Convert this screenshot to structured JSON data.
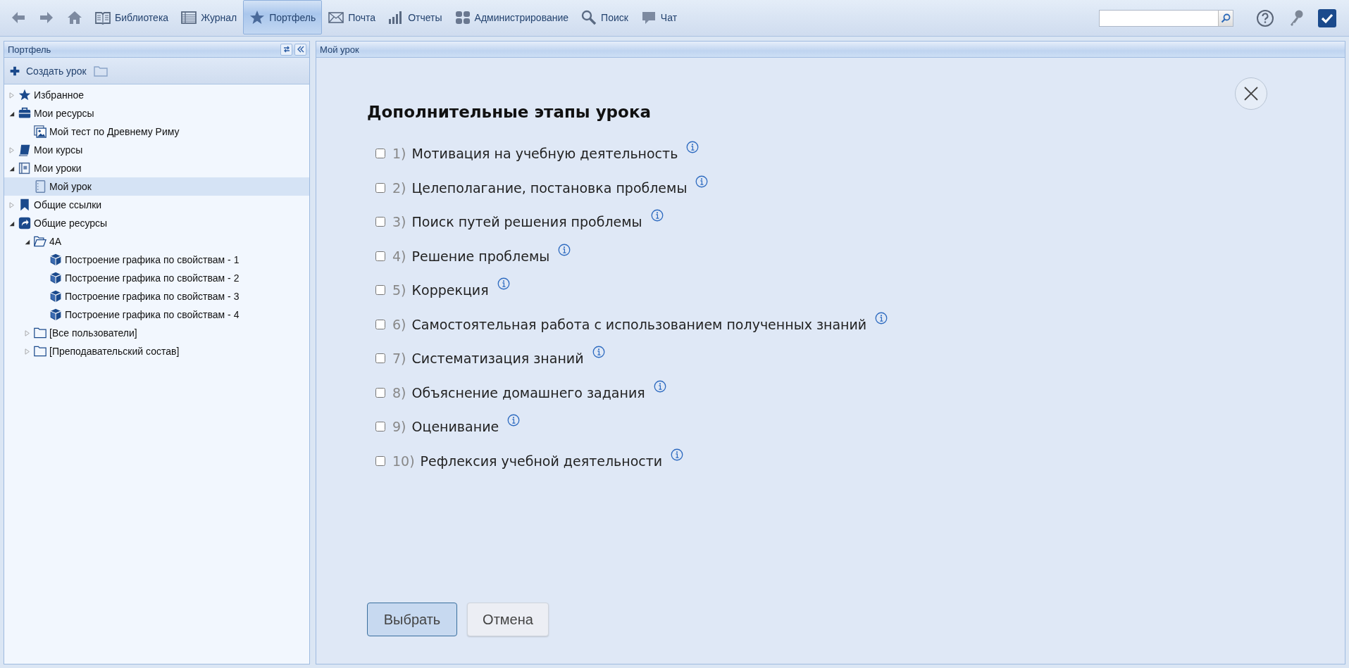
{
  "toolbar": {
    "items": [
      {
        "kind": "back",
        "selected": false
      },
      {
        "kind": "forward",
        "selected": false
      },
      {
        "kind": "home",
        "selected": false
      },
      {
        "kind": "book",
        "label": "Библиотека",
        "selected": false
      },
      {
        "kind": "journal",
        "label": "Журнал",
        "selected": false
      },
      {
        "kind": "star",
        "label": "Портфель",
        "selected": true
      },
      {
        "kind": "mail",
        "label": "Почта",
        "selected": false
      },
      {
        "kind": "chart",
        "label": "Отчеты",
        "selected": false
      },
      {
        "kind": "users",
        "label": "Администрирование",
        "selected": false
      },
      {
        "kind": "search",
        "label": "Поиск",
        "selected": false
      },
      {
        "kind": "chat",
        "label": "Чат",
        "selected": false
      }
    ]
  },
  "sidebar": {
    "title": "Портфель",
    "create_button": "Создать урок",
    "tree": [
      {
        "label": "Избранное",
        "kind": "star",
        "expanded": false,
        "selected": false
      },
      {
        "label": "Мои ресурсы",
        "kind": "briefcase",
        "expanded": true,
        "selected": false,
        "children": [
          {
            "label": "Мой тест по Древнему Риму",
            "kind": "image",
            "selected": false
          }
        ]
      },
      {
        "label": "Мои курсы",
        "kind": "book",
        "expanded": false,
        "selected": false
      },
      {
        "label": "Мои уроки",
        "kind": "lessons",
        "expanded": true,
        "selected": false,
        "children": [
          {
            "label": "Мой урок",
            "kind": "lesson",
            "selected": true
          }
        ]
      },
      {
        "label": "Общие ссылки",
        "kind": "bookmark",
        "expanded": false,
        "selected": false
      },
      {
        "label": "Общие ресурсы",
        "kind": "share",
        "expanded": true,
        "selected": false,
        "children": [
          {
            "label": "4А",
            "kind": "folder-open",
            "expanded": true,
            "selected": false,
            "children": [
              {
                "label": "Построение графика по свойствам - 1",
                "kind": "cube",
                "selected": false
              },
              {
                "label": "Построение графика по свойствам - 2",
                "kind": "cube",
                "selected": false
              },
              {
                "label": "Построение графика по свойствам - 3",
                "kind": "cube",
                "selected": false
              },
              {
                "label": "Построение графика по свойствам - 4",
                "kind": "cube",
                "selected": false
              }
            ]
          },
          {
            "label": "[Все пользователи]",
            "kind": "folder",
            "expanded": false,
            "selected": false
          },
          {
            "label": "[Преподавательский состав]",
            "kind": "folder",
            "expanded": false,
            "selected": false
          }
        ]
      }
    ]
  },
  "main": {
    "title": "Мой урок",
    "dialog": {
      "heading": "Дополнительные этапы урока",
      "stages": [
        {
          "number": "1)",
          "label": "Мотивация на учебную деятельность",
          "checked": false
        },
        {
          "number": "2)",
          "label": "Целеполагание, постановка проблемы",
          "checked": false
        },
        {
          "number": "3)",
          "label": "Поиск путей решения проблемы",
          "checked": false
        },
        {
          "number": "4)",
          "label": "Решение проблемы",
          "checked": false
        },
        {
          "number": "5)",
          "label": "Коррекция",
          "checked": false
        },
        {
          "number": "6)",
          "label": "Самостоятельная работа с использованием полученных знаний",
          "checked": false
        },
        {
          "number": "7)",
          "label": "Систематизация знаний",
          "checked": false
        },
        {
          "number": "8)",
          "label": "Объяснение домашнего задания",
          "checked": false
        },
        {
          "number": "9)",
          "label": "Оценивание",
          "checked": false
        },
        {
          "number": "10)",
          "label": "Рефлексия учебной деятельности",
          "checked": false
        }
      ],
      "buttons": [
        {
          "label": "Выбрать",
          "kind": "primary"
        },
        {
          "label": "Отмена",
          "kind": "secondary"
        }
      ]
    }
  }
}
